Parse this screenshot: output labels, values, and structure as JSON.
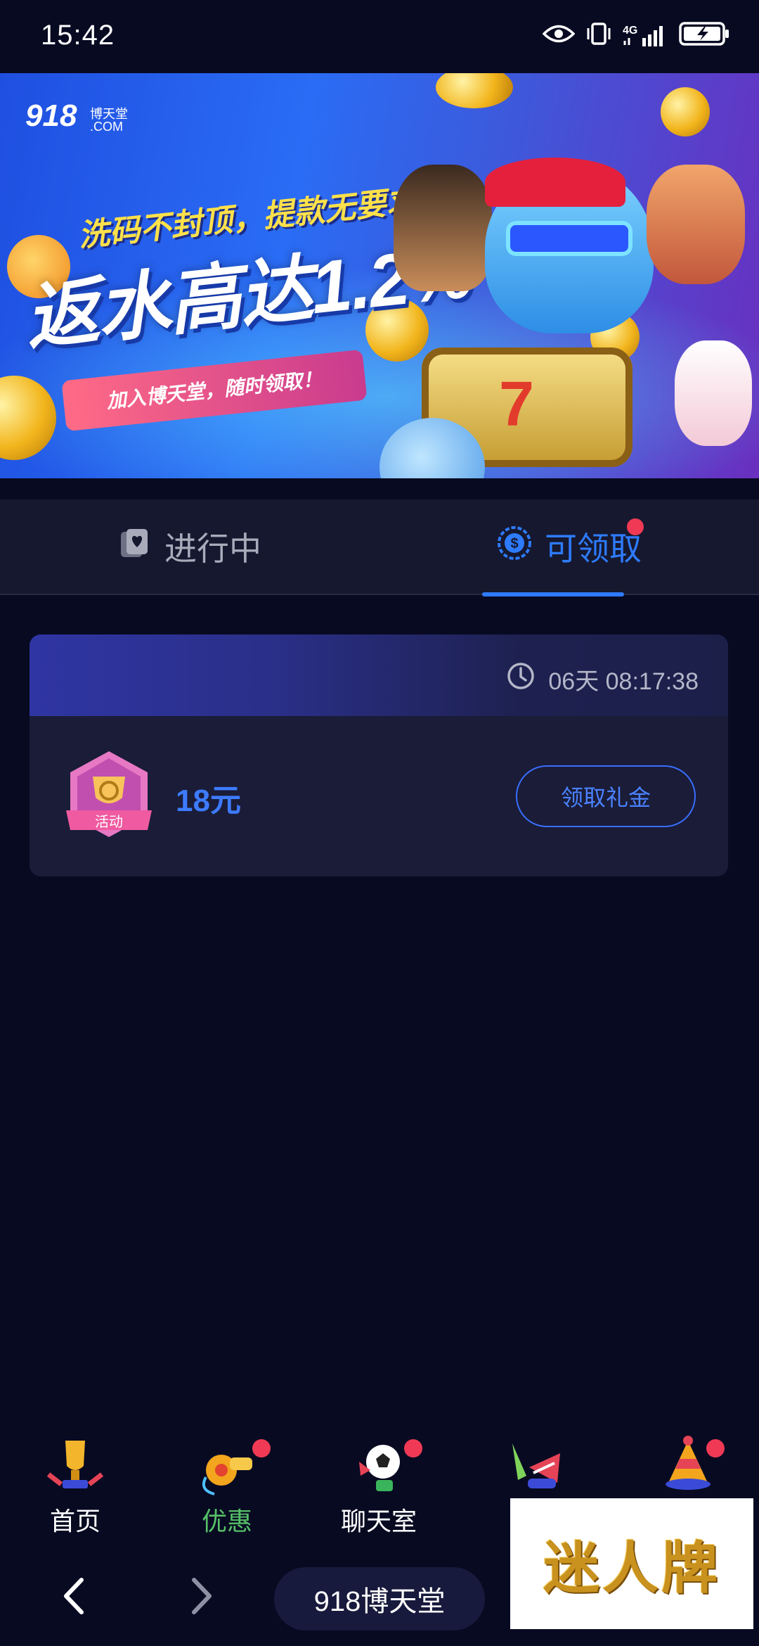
{
  "status_bar": {
    "time": "15:42",
    "network": "4G",
    "icons": [
      "eye-icon",
      "vibrate-icon",
      "signal-icon",
      "battery-charging-icon"
    ]
  },
  "banner": {
    "logo_number": "918",
    "logo_name": "博天堂",
    "logo_domain": ".COM",
    "headline_small": "洗码不封顶，提款无要求",
    "headline_big": "返水高达1.2%",
    "pill_text": "加入博天堂，随时领取！"
  },
  "tabs": [
    {
      "label": "进行中",
      "icon": "card-icon",
      "active": false
    },
    {
      "label": "可领取",
      "icon": "coin-icon",
      "active": true,
      "has_badge": true
    }
  ],
  "reward_card": {
    "countdown": "06天 08:17:38",
    "badge_label": "活动",
    "amount": "18元",
    "button_label": "领取礼金"
  },
  "bottom_nav": [
    {
      "label": "首页",
      "icon": "trophy-icon",
      "active": false,
      "badge": false
    },
    {
      "label": "优惠",
      "icon": "whistle-icon",
      "active": true,
      "badge": true
    },
    {
      "label": "聊天室",
      "icon": "soccer-ball-icon",
      "active": false,
      "badge": true
    },
    {
      "label": "",
      "icon": "party-horn-icon",
      "active": false,
      "badge": false
    },
    {
      "label": "",
      "icon": "party-hat-icon",
      "active": false,
      "badge": true
    }
  ],
  "browser_bar": {
    "site_label": "918博天堂"
  },
  "watermark": {
    "text": "迷人牌"
  },
  "colors": {
    "background": "#080a22",
    "accent_blue": "#2e7bff",
    "active_green": "#56c168",
    "badge_red": "#f03a55"
  }
}
